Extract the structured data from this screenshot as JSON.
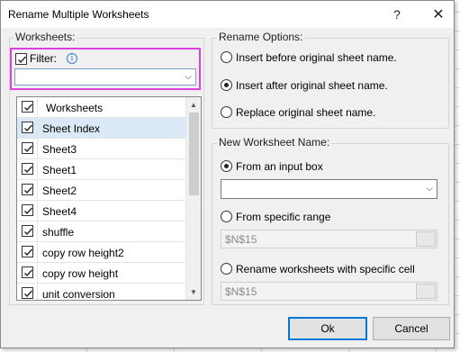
{
  "window": {
    "title": "Rename Multiple Worksheets",
    "help_glyph": "?",
    "close_glyph": "✕"
  },
  "worksheets": {
    "group_label": "Worksheets:",
    "filter": {
      "label": "Filter:",
      "checked": true,
      "value": ""
    },
    "list": {
      "header": "Worksheets",
      "items": [
        {
          "label": "Sheet Index",
          "checked": true,
          "selected": true
        },
        {
          "label": "Sheet3",
          "checked": true
        },
        {
          "label": "Sheet1",
          "checked": true
        },
        {
          "label": "Sheet2",
          "checked": true
        },
        {
          "label": "Sheet4",
          "checked": true
        },
        {
          "label": "shuffle",
          "checked": true
        },
        {
          "label": "copy row height2",
          "checked": true
        },
        {
          "label": "copy row height",
          "checked": true
        },
        {
          "label": "unit conversion",
          "checked": true
        }
      ]
    }
  },
  "rename_options": {
    "group_label": "Rename Options:",
    "insert_before": "Insert before original sheet name.",
    "insert_after": "Insert after original sheet name.",
    "replace": "Replace original sheet name.",
    "selected": "insert_after"
  },
  "new_name": {
    "group_label": "New Worksheet Name:",
    "from_input": "From an input box",
    "input_value": "",
    "from_range": "From specific range",
    "range_value": "$N$15",
    "from_cell": "Rename worksheets with specific cell",
    "cell_value": "$N$15",
    "selected": "from_input"
  },
  "buttons": {
    "ok": "Ok",
    "cancel": "Cancel"
  }
}
